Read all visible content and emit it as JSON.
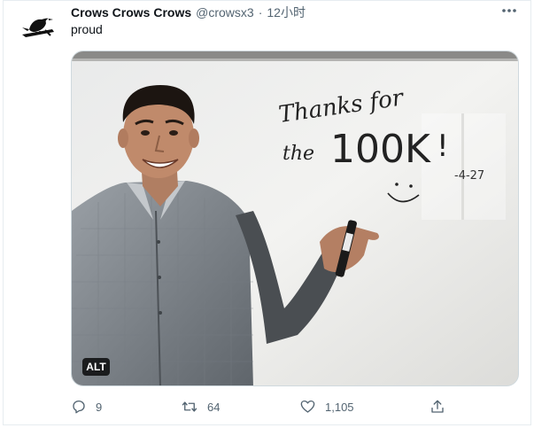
{
  "tweet": {
    "display_name": "Crows Crows Crows",
    "handle": "@crowsx3",
    "separator": "·",
    "time": "12小时",
    "text": "proud",
    "alt_badge": "ALT"
  },
  "image": {
    "whiteboard_lines": [
      "Thanks for",
      "the",
      "100K",
      "!"
    ],
    "whiteboard_date": "-4-27",
    "smiley": ":-)"
  },
  "actions": {
    "reply_count": "9",
    "retweet_count": "64",
    "like_count": "1,105"
  },
  "icons": {
    "more": "more-icon",
    "reply": "reply-icon",
    "retweet": "retweet-icon",
    "like": "like-icon",
    "share": "share-icon"
  },
  "colors": {
    "text_primary": "#0f1419",
    "text_secondary": "#536471",
    "border": "#cfd9de"
  }
}
